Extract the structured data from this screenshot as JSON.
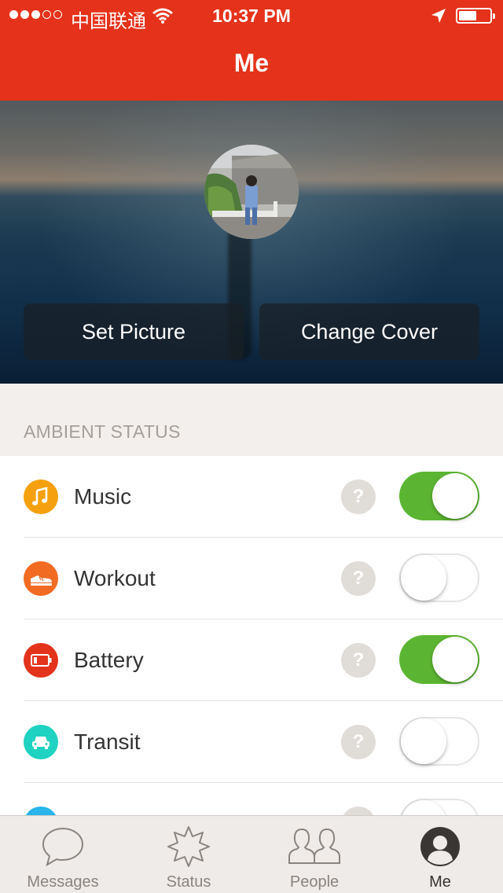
{
  "status_bar": {
    "carrier": "中国联通",
    "time": "10:37 PM",
    "signal_bars_filled": 3,
    "signal_bars_total": 5,
    "battery_level": 0.5,
    "icons": [
      "wifi-icon",
      "location-arrow-icon",
      "battery-icon"
    ]
  },
  "nav": {
    "title": "Me"
  },
  "cover": {
    "set_picture_label": "Set Picture",
    "change_cover_label": "Change Cover"
  },
  "section": {
    "title": "AMBIENT STATUS"
  },
  "colors": {
    "accent": "#e5321a",
    "toggle_on": "#5cb532",
    "music": "#f5a00e",
    "workout": "#f26b22",
    "battery": "#e3331c",
    "transit": "#1fd2c1",
    "partial": "#2bb4e9"
  },
  "items": [
    {
      "label": "Music",
      "icon": "music-note-icon",
      "help": "?",
      "enabled": true
    },
    {
      "label": "Workout",
      "icon": "sneaker-icon",
      "help": "?",
      "enabled": false
    },
    {
      "label": "Battery",
      "icon": "battery-level-icon",
      "help": "?",
      "enabled": true
    },
    {
      "label": "Transit",
      "icon": "car-icon",
      "help": "?",
      "enabled": false
    }
  ],
  "tabs": [
    {
      "label": "Messages",
      "icon": "speech-bubble-icon",
      "active": false
    },
    {
      "label": "Status",
      "icon": "starburst-icon",
      "active": false
    },
    {
      "label": "People",
      "icon": "people-icon",
      "active": false
    },
    {
      "label": "Me",
      "icon": "profile-avatar-icon",
      "active": true
    }
  ]
}
